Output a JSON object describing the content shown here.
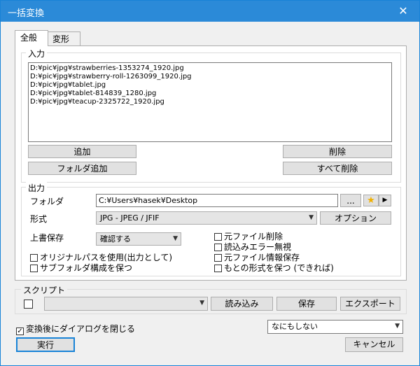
{
  "window": {
    "title": "一括変換",
    "close": "✕"
  },
  "tabs": [
    {
      "label": "全般"
    },
    {
      "label": "変形"
    }
  ],
  "input": {
    "group_label": "入力",
    "files": [
      "D:¥pic¥jpg¥strawberries-1353274_1920.jpg",
      "D:¥pic¥jpg¥strawberry-roll-1263099_1920.jpg",
      "D:¥pic¥jpg¥tablet.jpg",
      "D:¥pic¥jpg¥tablet-814839_1280.jpg",
      "D:¥pic¥jpg¥teacup-2325722_1920.jpg"
    ],
    "add_label": "追加",
    "add_folder_label": "フォルダ追加",
    "delete_label": "削除",
    "delete_all_label": "すべて削除"
  },
  "output": {
    "group_label": "出力",
    "folder_label": "フォルダ",
    "folder_value": "C:¥Users¥hasek¥Desktop",
    "browse_label": "...",
    "format_label": "形式",
    "format_value": "JPG - JPEG / JFIF",
    "options_label": "オプション",
    "overwrite_label": "上書保存",
    "overwrite_value": "確認する",
    "checks_left": [
      {
        "label": "オリジナルパスを使用(出力として)",
        "checked": false
      },
      {
        "label": "サブフォルダ構成を保つ",
        "checked": false
      }
    ],
    "checks_right": [
      {
        "label": "元ファイル削除",
        "checked": false
      },
      {
        "label": "読込みエラー無視",
        "checked": false
      },
      {
        "label": "元ファイル情報保存",
        "checked": false
      },
      {
        "label": "もとの形式を保つ (できれば)",
        "checked": false
      }
    ]
  },
  "script": {
    "group_label": "スクリプト",
    "select_value": "",
    "load_label": "読み込み",
    "save_label": "保存",
    "export_label": "エクスポート"
  },
  "bottom": {
    "close_after_label": "変換後にダイアログを閉じる",
    "close_after_checked": true,
    "after_action_value": "なにもしない",
    "run_label": "実行",
    "cancel_label": "キャンセル"
  }
}
